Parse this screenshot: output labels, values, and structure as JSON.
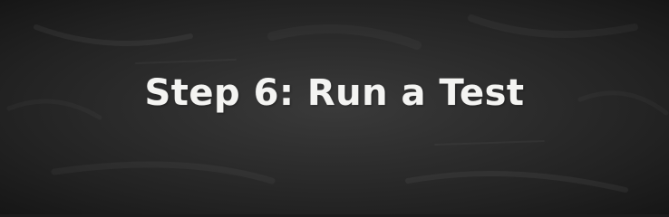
{
  "banner": {
    "title": "Step 6: Run a Test"
  },
  "colors": {
    "background": "#2e2e2e",
    "text": "#f4f4f2"
  }
}
